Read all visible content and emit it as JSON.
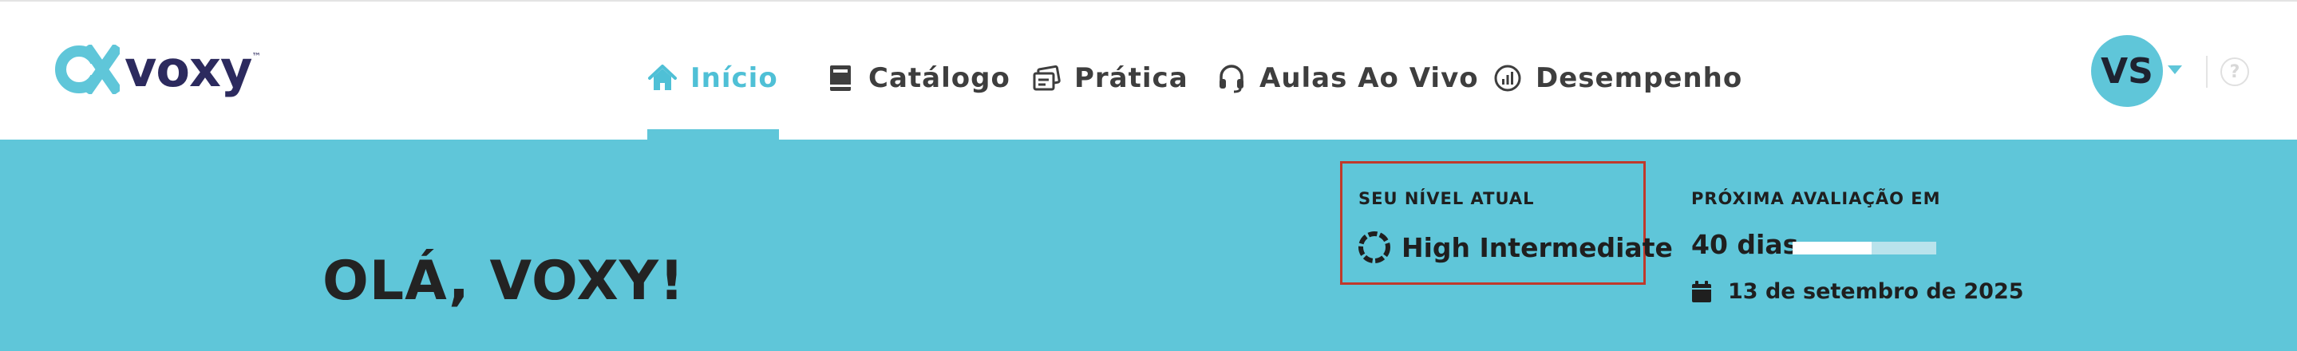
{
  "brand": {
    "name": "voxy",
    "tm": "™",
    "accent": "#5fc6d9",
    "dark": "#2c2a5e"
  },
  "nav": {
    "items": [
      {
        "label": "Início",
        "icon": "home-icon",
        "active": true
      },
      {
        "label": "Catálogo",
        "icon": "book-icon",
        "active": false
      },
      {
        "label": "Prática",
        "icon": "practice-icon",
        "active": false
      },
      {
        "label": "Aulas Ao Vivo",
        "icon": "headset-icon",
        "active": false
      },
      {
        "label": "Desempenho",
        "icon": "chart-icon",
        "active": false
      }
    ]
  },
  "user": {
    "initials": "VS"
  },
  "help": {
    "symbol": "?"
  },
  "banner": {
    "greeting": "OLÁ, VOXY!",
    "level": {
      "label": "SEU NÍVEL ATUAL",
      "value": "High Intermediate"
    },
    "next_eval": {
      "label": "PRÓXIMA AVALIAÇÃO EM",
      "days": "40 dias",
      "progress": 0.55,
      "date": "13 de setembro de 2025"
    }
  }
}
